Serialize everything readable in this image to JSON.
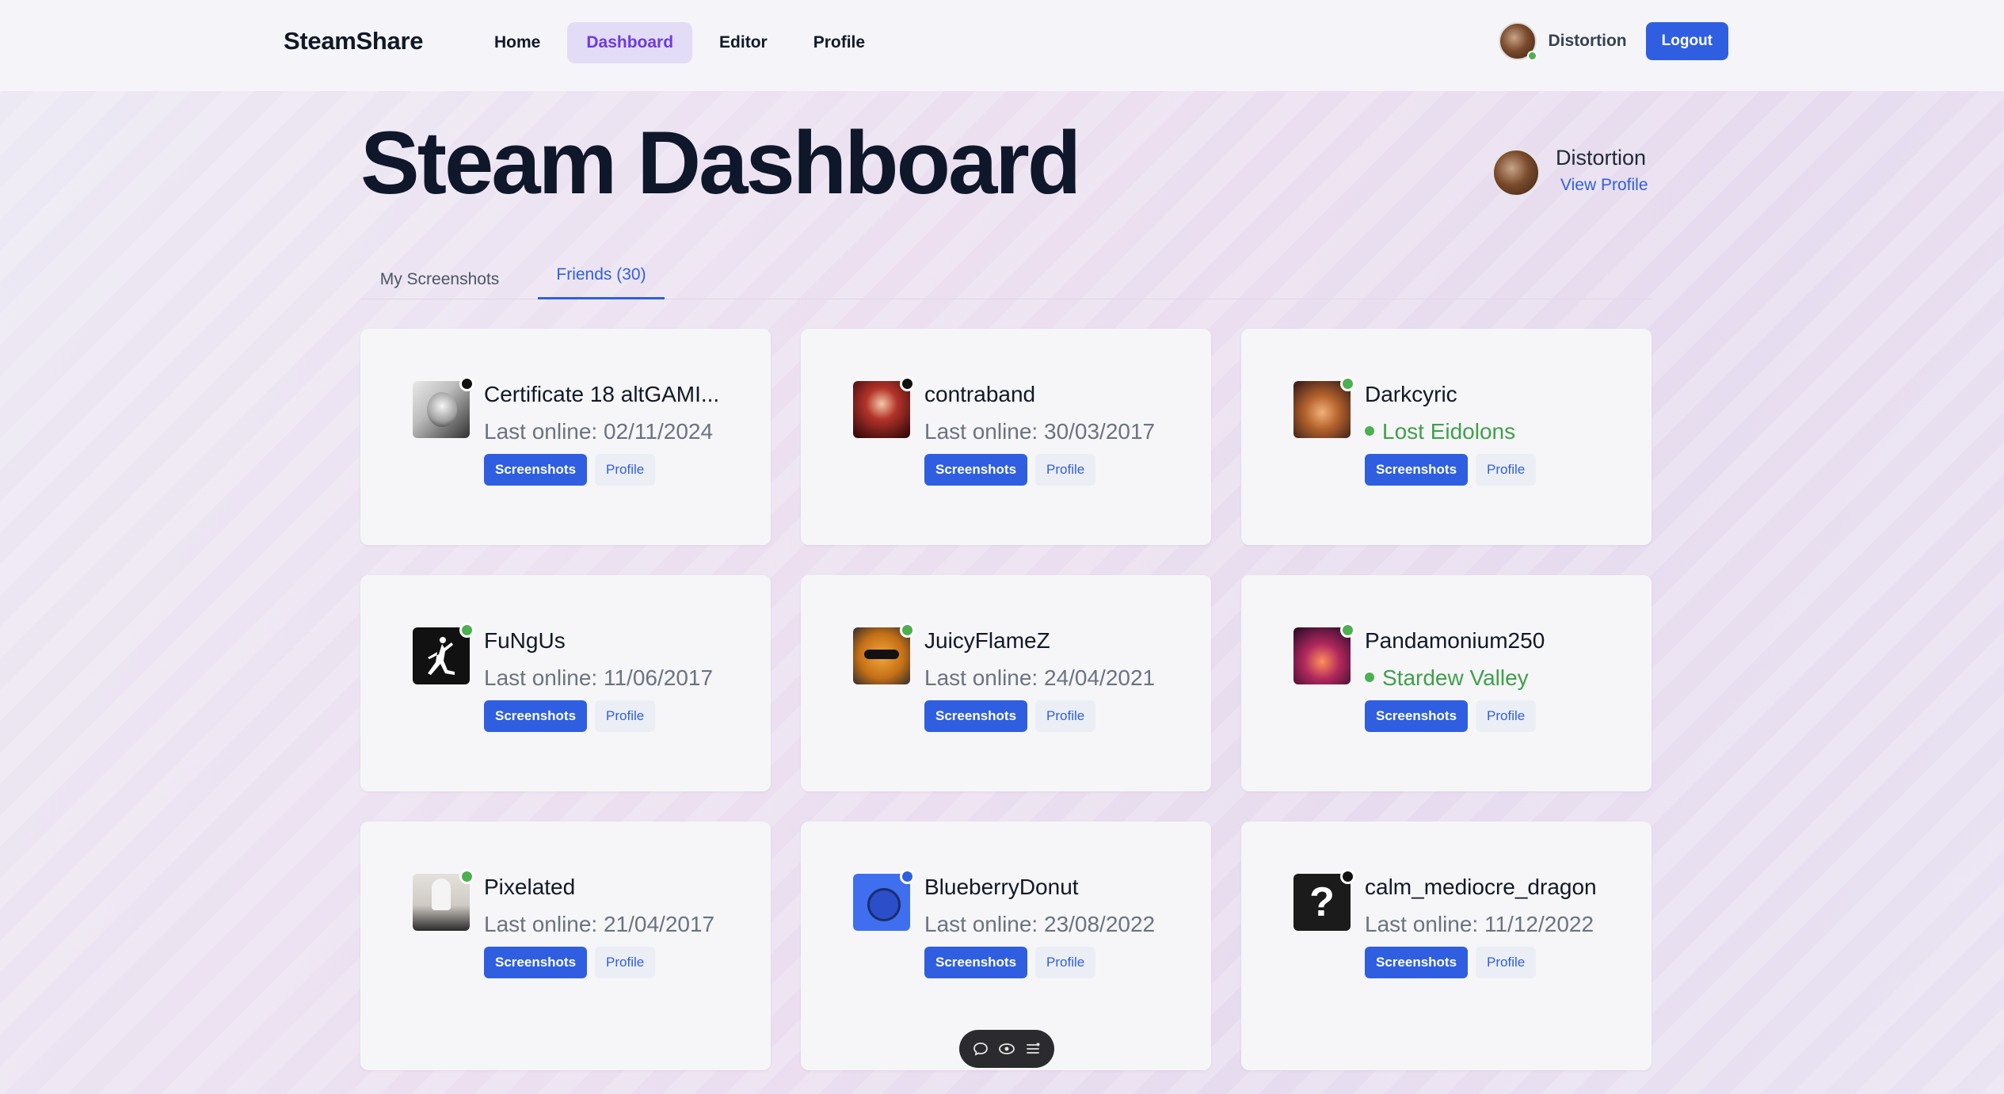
{
  "nav": {
    "brand": "SteamShare",
    "links": [
      "Home",
      "Dashboard",
      "Editor",
      "Profile"
    ],
    "active": "Dashboard",
    "username": "Distortion",
    "logout_label": "Logout"
  },
  "header": {
    "title": "Steam Dashboard",
    "profile_name": "Distortion",
    "view_profile_label": "View Profile"
  },
  "tabs": {
    "my_screenshots": "My Screenshots",
    "friends": "Friends (30)",
    "active": "Friends (30)"
  },
  "buttons": {
    "screenshots": "Screenshots",
    "profile": "Profile"
  },
  "friends": [
    {
      "name": "Certificate 18 altGAMI...",
      "status_text": "Last online: 02/11/2024",
      "online": false,
      "avatar": "bw-portrait"
    },
    {
      "name": "contraband",
      "status_text": "Last online: 30/03/2017",
      "online": false,
      "avatar": "red-mask"
    },
    {
      "name": "Darkcyric",
      "status_text": "Lost Eidolons",
      "online": true,
      "in_game": true,
      "avatar": "creature"
    },
    {
      "name": "FuNgUs",
      "status_text": "Last online: 11/06/2017",
      "online": true,
      "avatar": "jumpman-logo"
    },
    {
      "name": "JuicyFlameZ",
      "status_text": "Last online: 24/04/2021",
      "online": true,
      "avatar": "orange-sunglasses"
    },
    {
      "name": "Pandamonium250",
      "status_text": "Stardew Valley",
      "online": true,
      "in_game": true,
      "avatar": "pink-character"
    },
    {
      "name": "Pixelated",
      "status_text": "Last online: 21/04/2017",
      "online": true,
      "avatar": "white-figure"
    },
    {
      "name": "BlueberryDonut",
      "status_text": "Last online: 23/08/2022",
      "online": false,
      "avatar": "blue-blob"
    },
    {
      "name": "calm_mediocre_dragon",
      "status_text": "Last online: 11/12/2022",
      "online": false,
      "avatar": "question-mark"
    }
  ],
  "colors": {
    "accent": "#2f5fe0",
    "online": "#4caf50",
    "nav_active_bg": "#e3dcf6",
    "nav_active_text": "#6d3bdb"
  },
  "float_toolbar": {
    "icons": [
      "chat-bubble-icon",
      "eye-icon",
      "menu-lines-icon"
    ]
  }
}
